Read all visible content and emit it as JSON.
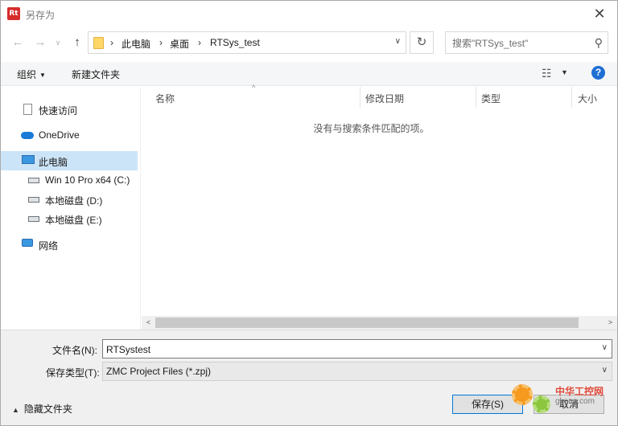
{
  "window": {
    "title": "另存为",
    "app_icon_text": "Rt",
    "close_symbol": "✕"
  },
  "nav": {
    "back_symbol": "←",
    "forward_symbol": "→",
    "dropdown_symbol": "∨",
    "up_symbol": "↑",
    "breadcrumb": [
      "此电脑",
      "桌面",
      "RTSys_test"
    ],
    "separator": "›",
    "address_dropdown_symbol": "∨",
    "refresh_symbol": "↻",
    "search_placeholder": "搜索\"RTSys_test\"",
    "search_icon": "⚲"
  },
  "toolbar": {
    "organize_label": "组织",
    "organize_caret": "▼",
    "new_folder_label": "新建文件夹",
    "view_icon": "☷",
    "view_caret": "▼",
    "help_label": "?"
  },
  "sidebar": {
    "items": [
      {
        "label": "快速访问",
        "icon": "document-icon"
      },
      {
        "label": "OneDrive",
        "icon": "cloud-icon"
      },
      {
        "label": "此电脑",
        "icon": "computer-icon",
        "selected": true
      },
      {
        "label": "Win 10 Pro x64 (C:)",
        "icon": "system-drive-icon"
      },
      {
        "label": "本地磁盘 (D:)",
        "icon": "drive-icon"
      },
      {
        "label": "本地磁盘 (E:)",
        "icon": "drive-icon"
      },
      {
        "label": "网络",
        "icon": "network-icon"
      }
    ]
  },
  "columns": {
    "name": "名称",
    "sort_caret": "^",
    "modified": "修改日期",
    "type": "类型",
    "size": "大小"
  },
  "content": {
    "empty_message": "没有与搜索条件匹配的项。"
  },
  "scrollbar": {
    "left_symbol": "<",
    "right_symbol": ">"
  },
  "form": {
    "filename_label": "文件名(N):",
    "filename_value": "RTSystest",
    "filetype_label": "保存类型(T):",
    "filetype_value": "ZMC Project Files (*.zpj)",
    "combo_dropdown_symbol": "∨",
    "hide_folders_caret": "▲",
    "hide_folders_label": "隐藏文件夹",
    "save_label": "保存(S)",
    "cancel_label": "取消"
  },
  "watermark": {
    "title": "中华工控网",
    "subtitle": "gkong.com"
  }
}
